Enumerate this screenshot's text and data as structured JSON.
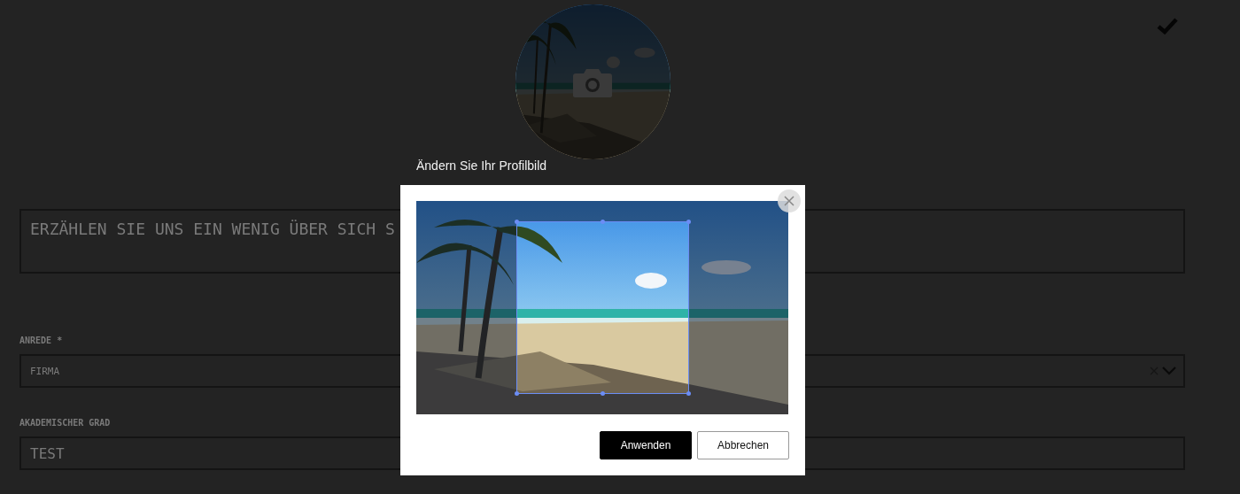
{
  "about": {
    "placeholder": "ERZÄHLEN SIE UNS EIN WENIG ÜBER SICH S"
  },
  "fields": [
    {
      "kind": "select",
      "label": "ANREDE *",
      "value": "FIRMA"
    },
    {
      "kind": "text",
      "label": "AKADEMISCHER GRAD",
      "value": "TEST"
    }
  ],
  "modal": {
    "caption": "Ändern Sie Ihr Profilbild",
    "buttons": [
      {
        "label": "Anwenden",
        "primary": true
      },
      {
        "label": "Abbrechen",
        "primary": false
      }
    ]
  }
}
